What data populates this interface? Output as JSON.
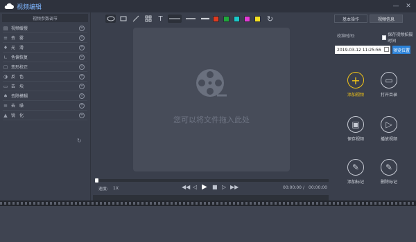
{
  "app": {
    "title": "视频编辑"
  },
  "left_panel": {
    "header": "视频参数调节",
    "items": [
      {
        "label": "视频缓慢",
        "icon": "layers-icon"
      },
      {
        "label": "去　雾",
        "icon": "fog-icon"
      },
      {
        "label": "光　滑",
        "icon": "drop-icon"
      },
      {
        "label": "色偏恢复",
        "icon": "color-icon"
      },
      {
        "label": "变形校正",
        "icon": "frame-icon"
      },
      {
        "label": "反　色",
        "icon": "contrast-icon"
      },
      {
        "label": "去　块",
        "icon": "block-icon"
      },
      {
        "label": "去除模糊",
        "icon": "blur-icon"
      },
      {
        "label": "去　噪",
        "icon": "noise-icon"
      },
      {
        "label": "锐　化",
        "icon": "sharpen-icon"
      }
    ]
  },
  "toolbar": {
    "tools": [
      "ellipse-tool-icon",
      "rect-tool-icon",
      "line-tool-icon",
      "mosaic-tool-icon",
      "text-tool-icon"
    ],
    "text_glyph": "T",
    "colors": [
      "#e03a1e",
      "#1fa83c",
      "#19c9c9",
      "#e33ad5",
      "#f5e01f"
    ]
  },
  "center": {
    "drop_text": "您可以将文件拖入此处"
  },
  "controls": {
    "speed_label": "速度:",
    "speed_value": "1X",
    "time_current": "00:00:00",
    "time_sep": "/",
    "time_total": "00:00:00"
  },
  "right_panel": {
    "tabs": [
      "基本操作",
      "视频信息"
    ],
    "calib_label": "校准时间:",
    "keep_label": "保存视频拍摄时间",
    "datetime": "2019-03-12  11:25:56",
    "preset_label": "预览位置",
    "actions": [
      {
        "label": "添加视频"
      },
      {
        "label": "打开目录"
      },
      {
        "label": "保存视频"
      },
      {
        "label": "播放视频"
      },
      {
        "label": "添加标记"
      },
      {
        "label": "删除标记"
      }
    ]
  }
}
